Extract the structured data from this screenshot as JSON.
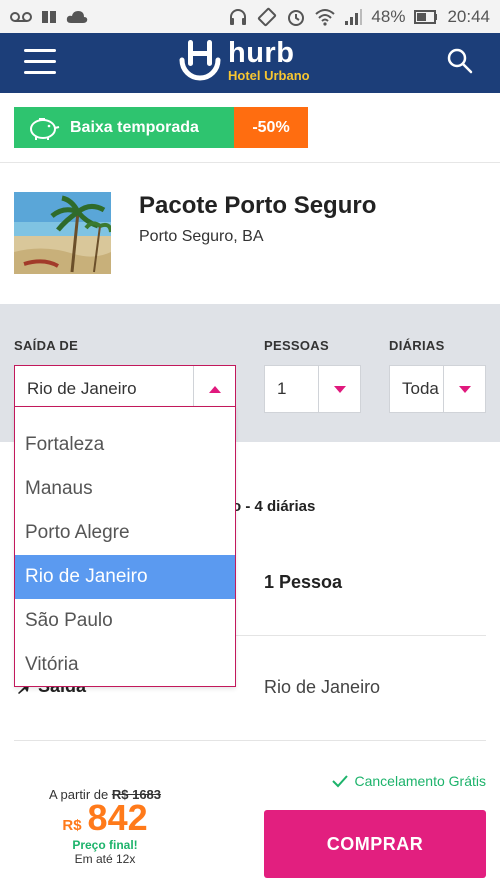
{
  "status_bar": {
    "battery": "48%",
    "time": "20:44",
    "icons": [
      "voicemail-icon",
      "book-icon",
      "cloud-icon",
      "headphones-icon",
      "rotate-icon",
      "alarm-icon",
      "wifi-icon",
      "signal-icon",
      "battery-icon"
    ]
  },
  "header": {
    "brand": "hurb",
    "brand_sub": "Hotel Urbano",
    "brand_color": "#1c3e79",
    "accent_color": "#f7c631"
  },
  "promo": {
    "label": "Baixa temporada",
    "discount": "-50%"
  },
  "package": {
    "title": "Pacote Porto Seguro",
    "location": "Porto Seguro, BA"
  },
  "filters": {
    "departure_label": "SAÍDA DE",
    "departure_value": "Rio de Janeiro",
    "people_label": "PESSOAS",
    "people_value": "1",
    "nights_label": "DIÁRIAS",
    "nights_value": "Toda"
  },
  "dropdown": {
    "options": [
      "Fortaleza",
      "Manaus",
      "Porto Alegre",
      "Rio de Janeiro",
      "São Paulo",
      "Vitória"
    ],
    "selected": "Rio de Janeiro"
  },
  "details": {
    "summary": "o - 4 diárias",
    "people": "1 Pessoa",
    "departure_label": "Saída",
    "departure_value": "Rio de Janeiro"
  },
  "footer": {
    "cancellation": "Cancelamento Grátis",
    "from_label": "A partir de",
    "old_price": "R$ 1683",
    "currency": "R$",
    "price": "842",
    "final_label": "Preço final!",
    "installments": "Em até 12x",
    "buy_label": "COMPRAR",
    "buy_color": "#e21f7f"
  }
}
